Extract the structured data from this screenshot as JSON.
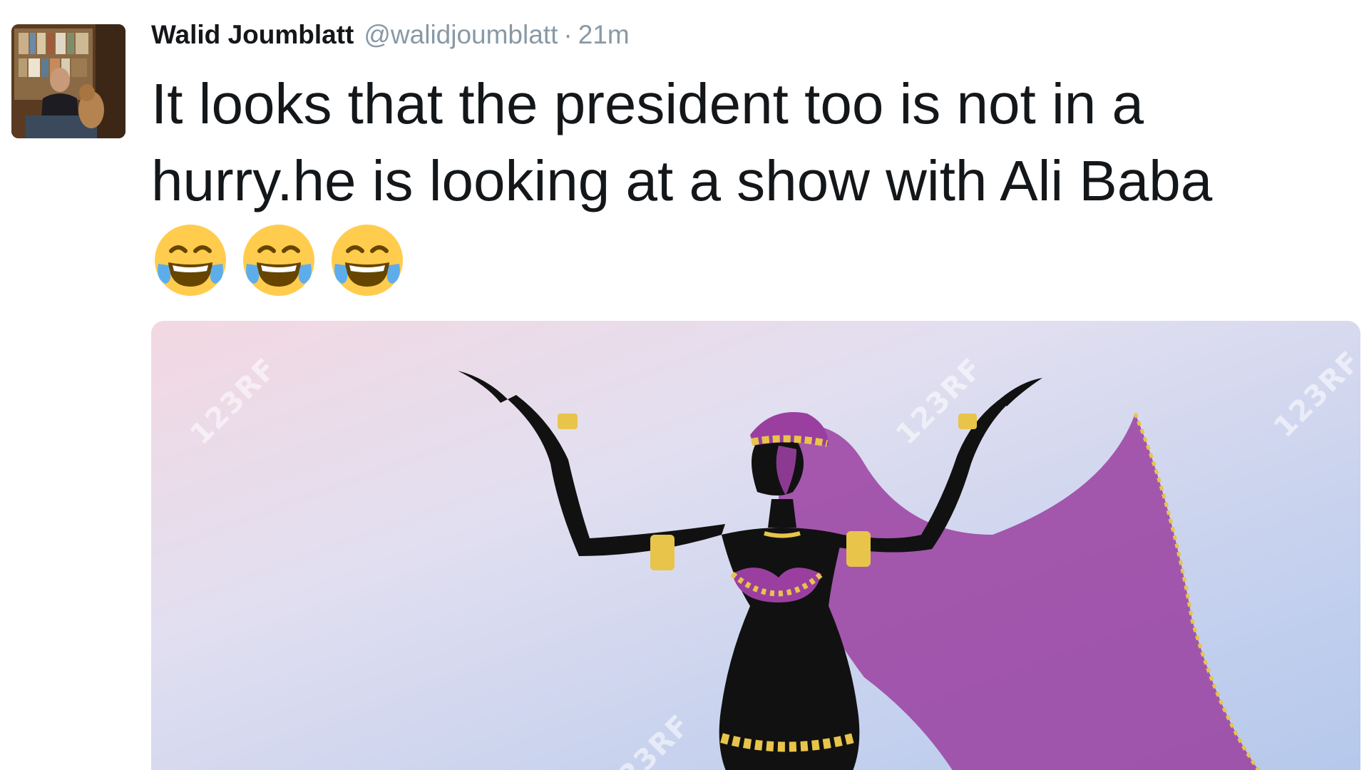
{
  "tweet": {
    "author_name": "Walid Joumblatt",
    "author_handle": "@walidjoumblatt",
    "separator": "·",
    "time": "21m",
    "text": "It looks that the president too is not in a hurry.he is looking at a show with Ali Baba",
    "emojis": [
      "face-with-tears-of-joy",
      "face-with-tears-of-joy",
      "face-with-tears-of-joy"
    ]
  },
  "media": {
    "watermark": "123RF",
    "colors": {
      "veil": "#9a3fa0",
      "gold": "#e8c44a",
      "silhouette": "#111111"
    }
  }
}
